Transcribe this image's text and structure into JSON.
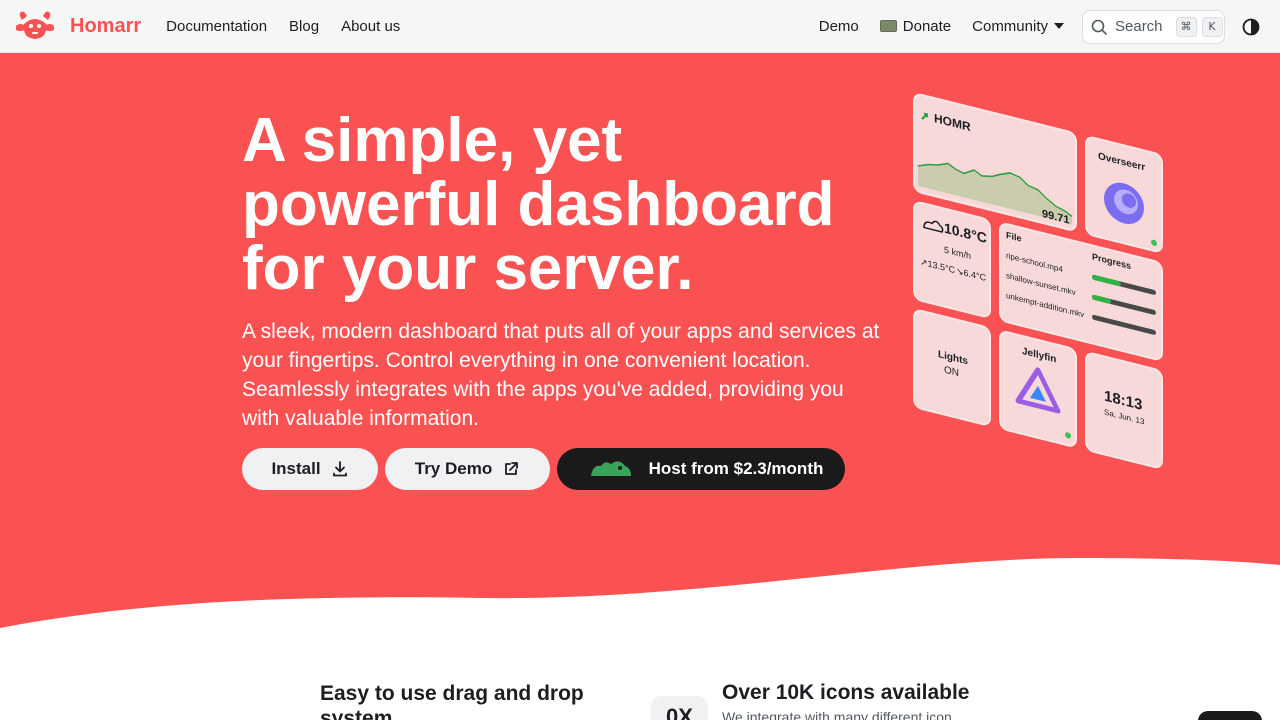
{
  "brand": {
    "name": "Homarr",
    "color": "#fa5252"
  },
  "nav": {
    "left": [
      "Documentation",
      "Blog",
      "About us"
    ],
    "demo": "Demo",
    "donate": "Donate",
    "community": "Community",
    "search": {
      "label": "Search",
      "key1": "⌘",
      "key2": "K"
    }
  },
  "hero": {
    "title_lines": [
      "A simple, yet",
      "powerful dashboard",
      "for your server."
    ],
    "subtitle": "A sleek, modern dashboard that puts all of your apps and services at your fingertips. Control everything in one convenient location. Seamlessly integrates with the apps you've added, providing you with valuable information.",
    "buttons": {
      "install": "Install",
      "demo": "Try Demo",
      "host": "Host from $2.3/month"
    }
  },
  "mockup": {
    "chart_title": "HOMR",
    "chart_value": "99.71",
    "overseerr": "Overseerr",
    "weather": {
      "temp": "10.8°C",
      "wind": "5 km/h",
      "high": "↗13.5°C",
      "low": "↘6.4°C"
    },
    "downloads": {
      "file_header": "File",
      "progress_header": "Progress",
      "files": [
        "ripe-school.mp4",
        "shallow-sunset.mkv",
        "unkempt-addition.mkv"
      ],
      "progress": [
        0.45,
        0.3,
        0.0
      ]
    },
    "lights": {
      "label": "Lights",
      "state": "ON"
    },
    "jellyfin": "Jellyfin",
    "clock": {
      "time": "18:13",
      "date": "Sa, Jun. 13"
    }
  },
  "features": {
    "f1_title_lines": [
      "Easy to use drag and drop",
      "system"
    ],
    "f2_title": "Over 10K icons available",
    "f2_desc": "We integrate with many different icon",
    "f2_icon": "0X"
  }
}
